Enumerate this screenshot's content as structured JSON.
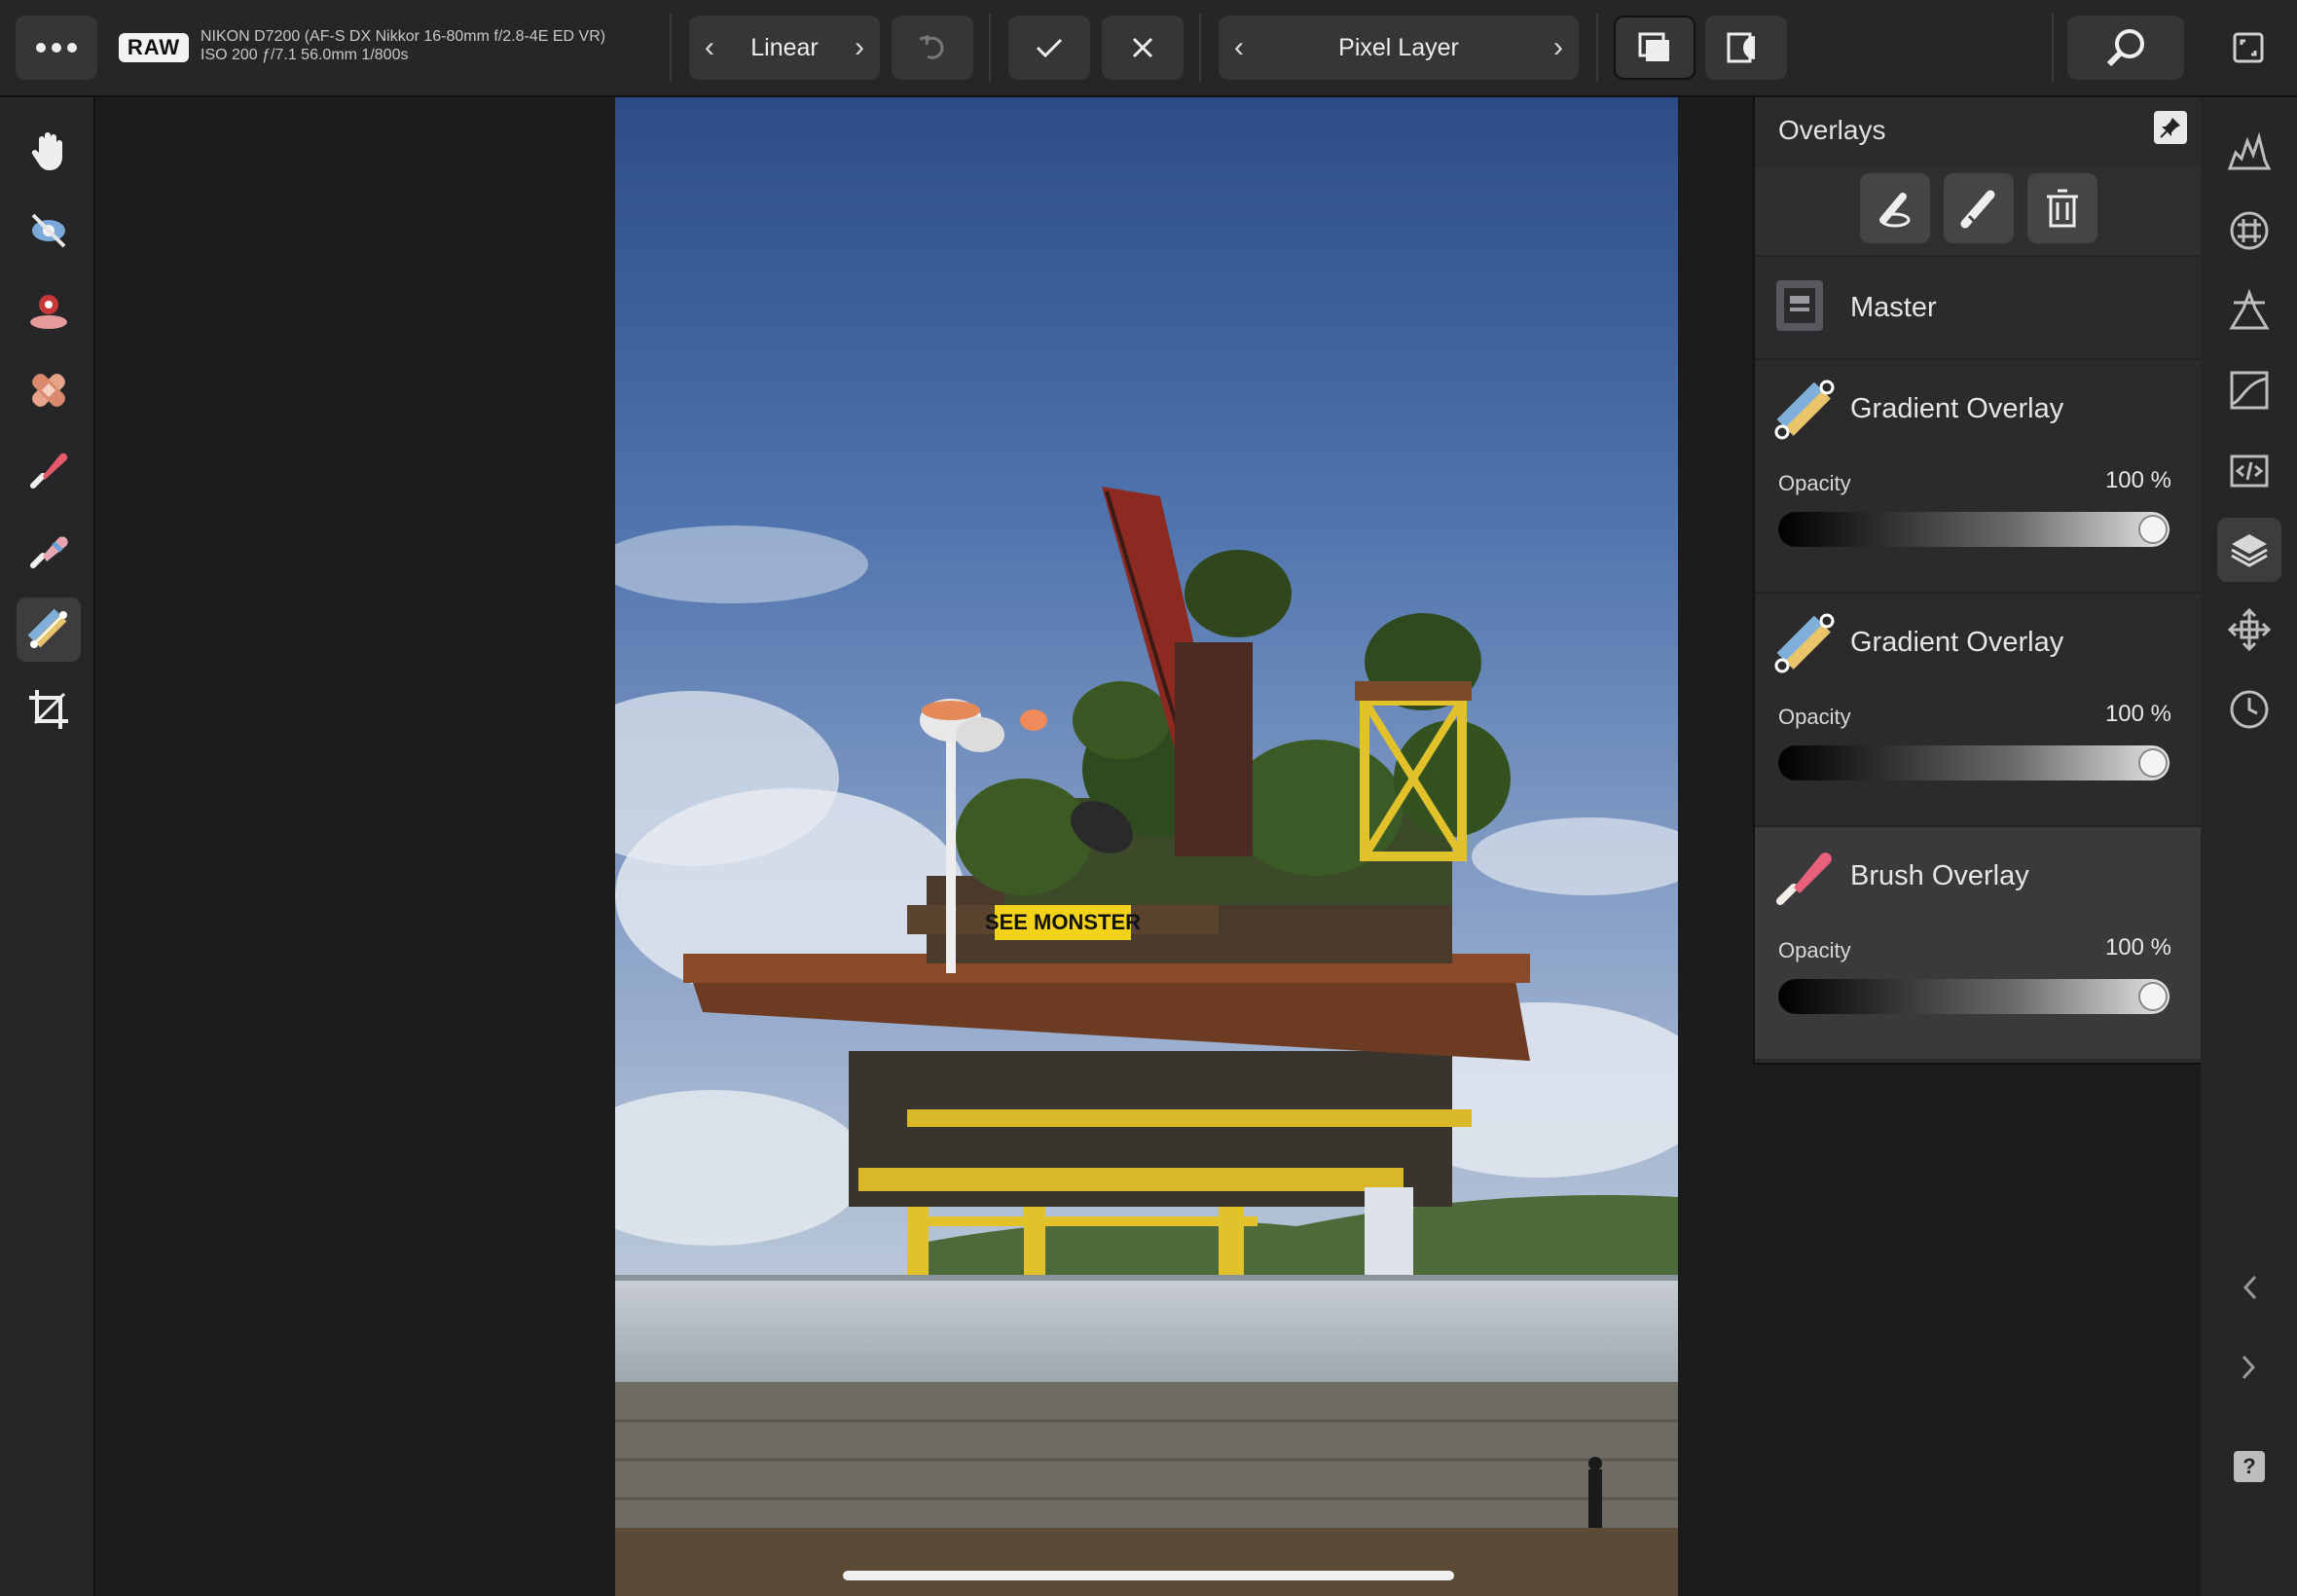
{
  "toolbar": {
    "more_icon": "more-dots-icon",
    "raw_badge": "RAW",
    "camera_line1": "NIKON D7200 (AF-S DX Nikkor 16-80mm f/2.8-4E ED VR)",
    "camera_line2": "ISO 200 ƒ/7.1 56.0mm 1/800s",
    "gradient_type": "Linear",
    "layer_selector": "Pixel Layer"
  },
  "left_tools": [
    {
      "name": "hand-tool",
      "icon": "hand-icon"
    },
    {
      "name": "red-eye-tool",
      "icon": "eye-icon"
    },
    {
      "name": "spot-tool",
      "icon": "spot-icon"
    },
    {
      "name": "bandage-tool",
      "icon": "bandage-icon"
    },
    {
      "name": "paint-brush-tool",
      "icon": "brush-icon"
    },
    {
      "name": "erase-brush-tool",
      "icon": "eraser-icon"
    },
    {
      "name": "gradient-overlay-tool",
      "icon": "gradient-icon",
      "active": true
    },
    {
      "name": "crop-tool",
      "icon": "crop-icon"
    }
  ],
  "panel": {
    "title": "Overlays",
    "items": [
      {
        "title": "Master"
      },
      {
        "title": "Gradient Overlay",
        "opacity_label": "Opacity",
        "opacity_value": "100 %",
        "opacity": 1.0
      },
      {
        "title": "Gradient Overlay",
        "opacity_label": "Opacity",
        "opacity_value": "100 %",
        "opacity": 1.0
      },
      {
        "title": "Brush Overlay",
        "opacity_label": "Opacity",
        "opacity_value": "100 %",
        "opacity": 1.0
      }
    ]
  },
  "photo": {
    "sign_text": "SEE MONSTER"
  },
  "colors": {
    "accent_yellow": "#e8c21a",
    "sky_top": "#2c4c86",
    "sky_bottom": "#a9b9d2"
  },
  "help_label": "?"
}
